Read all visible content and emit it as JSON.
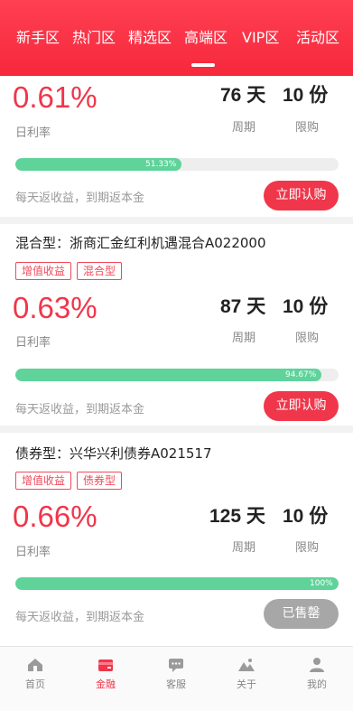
{
  "tabs": [
    {
      "label": "新手区"
    },
    {
      "label": "热门区"
    },
    {
      "label": "精选区"
    },
    {
      "label": "高端区"
    },
    {
      "label": "VIP区"
    },
    {
      "label": "活动区"
    }
  ],
  "active_tab": "高端区",
  "products": [
    {
      "title": "",
      "tags": [],
      "rate": "0.61%",
      "rate_label": "日利率",
      "period": "76 天",
      "period_label": "周期",
      "limit": "10 份",
      "limit_label": "限购",
      "progress_text": "51.33%",
      "progress": 0.5133,
      "note": "每天返收益，到期返本金",
      "button": "立即认购"
    },
    {
      "title": "混合型：浙商汇金红利机遇混合A022000",
      "tags": [
        "增值收益",
        "混合型"
      ],
      "rate": "0.63%",
      "rate_label": "日利率",
      "period": "87 天",
      "period_label": "周期",
      "limit": "10 份",
      "limit_label": "限购",
      "progress_text": "94.67%",
      "progress": 0.9467,
      "note": "每天返收益，到期返本金",
      "button": "立即认购"
    },
    {
      "title": "债券型：兴华兴利债券A021517",
      "tags": [
        "增值收益",
        "债券型"
      ],
      "rate": "0.66%",
      "rate_label": "日利率",
      "period": "125 天",
      "period_label": "周期",
      "limit": "10 份",
      "limit_label": "限购",
      "progress_text": "100%",
      "progress": 1.0,
      "note": "每天返收益，到期返本金",
      "button": "已售罄"
    }
  ],
  "bottom_nav": [
    {
      "label": "首页",
      "icon": "home-icon"
    },
    {
      "label": "金融",
      "icon": "finance-icon"
    },
    {
      "label": "客服",
      "icon": "customer-service-icon"
    },
    {
      "label": "关于",
      "icon": "about-icon"
    },
    {
      "label": "我的",
      "icon": "profile-icon"
    }
  ],
  "active_nav": "金融",
  "colors": {
    "brand_red": "#f0364a",
    "progress_green": "#5fd39a",
    "soldout_gray": "#a7a7a7"
  }
}
